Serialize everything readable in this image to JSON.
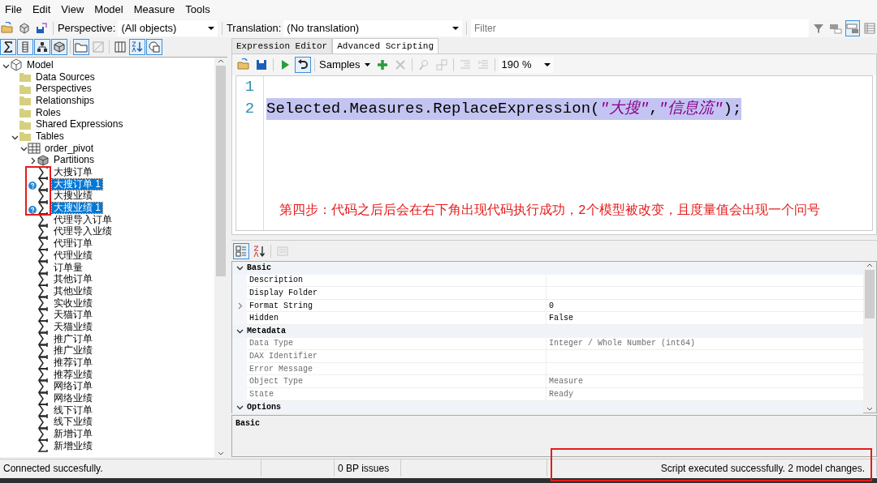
{
  "menu": [
    "File",
    "Edit",
    "View",
    "Model",
    "Measure",
    "Tools"
  ],
  "toolbar": {
    "buttons": [
      {
        "kind": "open"
      },
      {
        "kind": "refresh"
      },
      {
        "kind": "deploy"
      }
    ],
    "perspective_label": "Perspective:",
    "perspective": "(All objects)",
    "translation_label": "Translation:",
    "translation": "(No translation)",
    "filter_placeholder": "Filter",
    "view_buttons": [
      {
        "kind": "filter",
        "active": false
      },
      {
        "kind": "view-a",
        "active": false
      },
      {
        "kind": "view-b",
        "active": true
      },
      {
        "kind": "grid",
        "active": false
      }
    ]
  },
  "tree_toolbar": [
    {
      "kind": "sigma",
      "active": true
    },
    {
      "kind": "column",
      "active": true
    },
    {
      "kind": "hierarchy",
      "active": true
    },
    {
      "kind": "cube",
      "active": true
    },
    {
      "kind": "sep"
    },
    {
      "kind": "folder",
      "active": true
    },
    {
      "kind": "slash",
      "active": false
    },
    {
      "kind": "sep"
    },
    {
      "kind": "columns",
      "active": false
    },
    {
      "kind": "sort",
      "active": true
    },
    {
      "kind": "overlay",
      "active": true
    }
  ],
  "tree": [
    {
      "label": "Model",
      "kind": "model",
      "expanded": true,
      "children": [
        {
          "label": "Data Sources",
          "kind": "folder"
        },
        {
          "label": "Perspectives",
          "kind": "folder"
        },
        {
          "label": "Relationships",
          "kind": "folder"
        },
        {
          "label": "Roles",
          "kind": "folder"
        },
        {
          "label": "Shared Expressions",
          "kind": "folder"
        },
        {
          "label": "Tables",
          "kind": "folder",
          "expanded": true,
          "children": [
            {
              "label": "order_pivot",
              "kind": "table",
              "expanded": true,
              "children": [
                {
                  "label": "Partitions",
                  "kind": "partitions",
                  "expanded": false
                },
                {
                  "label": "大搜订单",
                  "kind": "measure",
                  "selected": false,
                  "warning": false,
                  "annotated": true
                },
                {
                  "label": "大搜订单 1",
                  "kind": "measure",
                  "selected": true,
                  "warning": true,
                  "annotated": true
                },
                {
                  "label": "大搜业绩",
                  "kind": "measure",
                  "selected": false,
                  "warning": false,
                  "annotated": true
                },
                {
                  "label": "大搜业绩 1",
                  "kind": "measure",
                  "selected": true,
                  "warning": true,
                  "annotated": true
                },
                {
                  "label": "代理导入订单",
                  "kind": "measure",
                  "selected": false,
                  "warning": false
                },
                {
                  "label": "代理导入业绩",
                  "kind": "measure",
                  "selected": false,
                  "warning": false
                },
                {
                  "label": "代理订单",
                  "kind": "measure",
                  "selected": false,
                  "warning": false
                },
                {
                  "label": "代理业绩",
                  "kind": "measure",
                  "selected": false,
                  "warning": false
                },
                {
                  "label": "订单量",
                  "kind": "measure",
                  "selected": false,
                  "warning": false
                },
                {
                  "label": "其他订单",
                  "kind": "measure",
                  "selected": false,
                  "warning": false
                },
                {
                  "label": "其他业绩",
                  "kind": "measure",
                  "selected": false,
                  "warning": false
                },
                {
                  "label": "实收业绩",
                  "kind": "measure",
                  "selected": false,
                  "warning": false
                },
                {
                  "label": "天猫订单",
                  "kind": "measure",
                  "selected": false,
                  "warning": false
                },
                {
                  "label": "天猫业绩",
                  "kind": "measure",
                  "selected": false,
                  "warning": false
                },
                {
                  "label": "推广订单",
                  "kind": "measure",
                  "selected": false,
                  "warning": false
                },
                {
                  "label": "推广业绩",
                  "kind": "measure",
                  "selected": false,
                  "warning": false
                },
                {
                  "label": "推荐订单",
                  "kind": "measure",
                  "selected": false,
                  "warning": false
                },
                {
                  "label": "推荐业绩",
                  "kind": "measure",
                  "selected": false,
                  "warning": false
                },
                {
                  "label": "网络订单",
                  "kind": "measure",
                  "selected": false,
                  "warning": false
                },
                {
                  "label": "网络业绩",
                  "kind": "measure",
                  "selected": false,
                  "warning": false
                },
                {
                  "label": "线下订单",
                  "kind": "measure",
                  "selected": false,
                  "warning": false
                },
                {
                  "label": "线下业绩",
                  "kind": "measure",
                  "selected": false,
                  "warning": false
                },
                {
                  "label": "新增订单",
                  "kind": "measure",
                  "selected": false,
                  "warning": false
                },
                {
                  "label": "新增业绩",
                  "kind": "measure",
                  "selected": false,
                  "warning": false
                }
              ]
            }
          ]
        }
      ]
    }
  ],
  "editor_tabs": [
    {
      "label": "Expression Editor",
      "selected": false
    },
    {
      "label": "Advanced Scripting",
      "selected": true
    }
  ],
  "script_toolbar": {
    "buttons": [
      {
        "kind": "open",
        "disabled": false,
        "active": false
      },
      {
        "kind": "save",
        "disabled": false,
        "active": false
      },
      {
        "kind": "sep"
      },
      {
        "kind": "run",
        "disabled": false,
        "active": false
      },
      {
        "kind": "undo",
        "disabled": false,
        "active": true
      }
    ],
    "samples": "Samples",
    "buttons2": [
      {
        "kind": "add",
        "disabled": false
      },
      {
        "kind": "delete",
        "disabled": true
      },
      {
        "kind": "sep"
      },
      {
        "kind": "find",
        "disabled": true
      },
      {
        "kind": "replace",
        "disabled": true
      },
      {
        "kind": "sep"
      },
      {
        "kind": "indent",
        "disabled": true
      },
      {
        "kind": "outdent",
        "disabled": true
      }
    ],
    "zoom": "190 %"
  },
  "code_lines": [
    {
      "number": "1"
    },
    {
      "number": "2",
      "selected": true,
      "tokens": [
        {
          "kind": "plain",
          "text": "Selected.Measures.ReplaceExpression("
        },
        {
          "kind": "string",
          "text": "\"大搜\""
        },
        {
          "kind": "plain",
          "text": ","
        },
        {
          "kind": "string",
          "text": "\"信息流\""
        },
        {
          "kind": "plain",
          "text": ");"
        }
      ]
    }
  ],
  "annotation_note": "第四步：代码之后后会在右下角出现代码执行成功，2个模型被改变，且度量值会出现一个问号",
  "property_toolbar": [
    {
      "kind": "categorized",
      "active": true,
      "disabled": false
    },
    {
      "kind": "alphabetical",
      "active": false,
      "disabled": false
    },
    {
      "kind": "sep"
    },
    {
      "kind": "pages",
      "active": false,
      "disabled": true
    }
  ],
  "properties": [
    {
      "category": "Basic",
      "expanded": true,
      "rows": [
        {
          "name": "Description",
          "readonly": false
        },
        {
          "name": "Display Folder",
          "readonly": false
        },
        {
          "name": "Format String",
          "value": "0",
          "readonly": false,
          "expandable": true
        },
        {
          "name": "Hidden",
          "value": "False",
          "readonly": false
        }
      ]
    },
    {
      "category": "Metadata",
      "expanded": true,
      "rows": [
        {
          "name": "Data Type",
          "value": "Integer / Whole Number (int64)",
          "readonly": true
        },
        {
          "name": "DAX Identifier",
          "readonly": true
        },
        {
          "name": "Error Message",
          "readonly": true
        },
        {
          "name": "Object Type",
          "value": "Measure",
          "readonly": true
        },
        {
          "name": "State",
          "value": "Ready",
          "readonly": true
        }
      ]
    },
    {
      "category": "Options",
      "expanded": true
    }
  ],
  "description_title": "Basic",
  "status_bar": [
    {
      "text": "Connected succesfully."
    },
    {
      "text": "0 BP issues"
    },
    {
      "text": "Script executed successfully. 2 model changes.",
      "annotated": true
    }
  ]
}
